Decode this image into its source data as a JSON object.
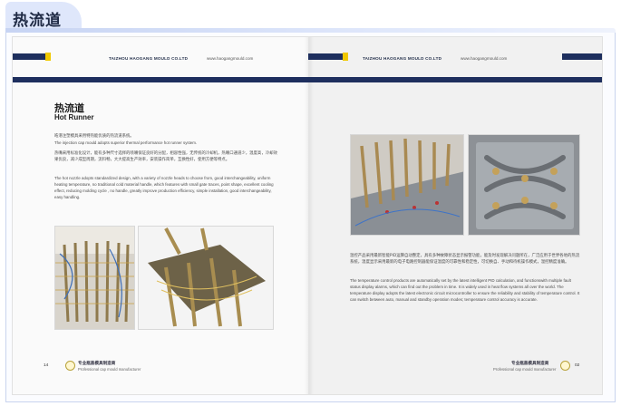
{
  "article": {
    "tab_title": "热流道"
  },
  "brochure": {
    "header_left": {
      "company": "TAIZHOU HAOGANG MOULD CO.LTD",
      "url": "www.haogangmould.com"
    },
    "header_right": {
      "company": "TAIZHOU HAOGANG MOULD CO.LTD",
      "url": "www.haogangmould.com"
    },
    "section": {
      "title_zh": "热流道",
      "title_en": "Hot Runner",
      "para1_zh": "皓港注塑模具采用特热能优质的热流道系统。",
      "para1_en": "The injection cap mould adopts superior thermal performance hot runner system.",
      "para2_zh": "热嘴采用标准化设计，能有多种尺寸选择的喷嘴保证良好的分配，相容性强，无传统的冷却机，热嘴口通道少，温度高，冷却效果优良，减少成型周期，流料畅，大大提高生产效率，安装操作简单，互换性好，使用方便等特点。",
      "para2_en": "The hot nozzle adopts standardized design, with a variety of nozzle heads to choose from, good interchangeability, uniform heating temperature, no traditional cold material handle, which features with small gate traces, point shape, excellent cooling effect, reducing molding cycle , no handle, greatly improve production efficiency, simple installation, good interchangeability, easy handling.",
      "para3_zh": "温控产品采用最新智能PID运算自动整定，具有多种故障状态显示报警功能，能及时发现解决问题所在，广泛应用于世界各地的热流系统，温度显示采用最新的电子电路控制器能保证温度的可靠性和稳定性，可切换自、手动和待机操作模式，温控精度准确。",
      "para3_en": "The temperature control products are automatically set by the latest intelligent PID calculation, and functionswith multiple fault status display alarms, which can find out the problem in time. It is widely used in heat flow systems all over the world. The temperature display adopts the latest electronic circuit microcontroller to ensure the reliability and stability of temperature control. It can switch between auto, manual and standby operation modes; temperature control accuracy is accurate."
    },
    "footer_left": {
      "page": "14",
      "brand": "专业瓶盖模具制造商",
      "sub": "Professional cap mould manufacturer"
    },
    "footer_right": {
      "page": "02",
      "brand": "专业瓶盖模具制造商",
      "sub": "Professional cap mould manufacturer"
    }
  },
  "colors": {
    "navy": "#1e2f5e",
    "accent": "#f0c800",
    "tab_bg": "#dfe7fb"
  }
}
